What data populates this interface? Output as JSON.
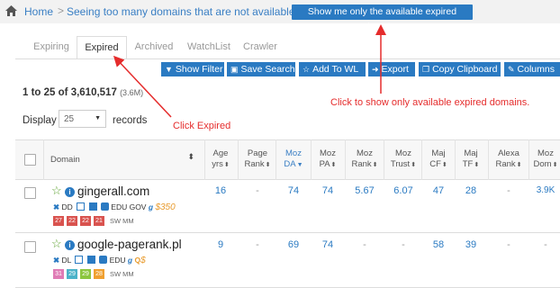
{
  "breadcrumb": {
    "home": "Home",
    "separator": ">",
    "text": "Seeing too many domains that are not available?"
  },
  "available_button": "Show me only the available expired domains",
  "tabs": [
    "Expiring",
    "Expired",
    "Archived",
    "WatchList",
    "Crawler"
  ],
  "active_tab": "Expired",
  "toolbar": {
    "show_filter": "Show Filter",
    "save_search": "Save Search",
    "add_to_wl": "Add To WL",
    "export": "Export",
    "copy_clipboard": "Copy Clipboard",
    "columns": "Columns"
  },
  "range": {
    "text": "1 to 25 of",
    "total": "3,610,517",
    "short": "(3.6M)"
  },
  "display": {
    "label": "Display",
    "value": "25",
    "suffix": "records"
  },
  "annotations": {
    "click_expired": "Click Expired",
    "click_available": "Click to show only available expired domains."
  },
  "columns": [
    {
      "key": "domain",
      "lines": [
        "Domain"
      ]
    },
    {
      "key": "age",
      "lines": [
        "Age",
        "yrs"
      ]
    },
    {
      "key": "page_rank",
      "lines": [
        "Page",
        "Rank"
      ]
    },
    {
      "key": "moz_da",
      "lines": [
        "Moz",
        "DA"
      ]
    },
    {
      "key": "moz_pa",
      "lines": [
        "Moz",
        "PA"
      ]
    },
    {
      "key": "moz_rank",
      "lines": [
        "Moz",
        "Rank"
      ]
    },
    {
      "key": "moz_trust",
      "lines": [
        "Moz",
        "Trust"
      ]
    },
    {
      "key": "maj_cf",
      "lines": [
        "Maj",
        "CF"
      ]
    },
    {
      "key": "maj_tf",
      "lines": [
        "Maj",
        "TF"
      ]
    },
    {
      "key": "alexa_rank",
      "lines": [
        "Alexa",
        "Rank"
      ]
    },
    {
      "key": "moz_dom",
      "lines": [
        "Moz",
        "Dom"
      ]
    }
  ],
  "rows": [
    {
      "domain": "gingerall.com",
      "sub": {
        "status": "DD",
        "edu": "EDU GOV",
        "price": "$350"
      },
      "badges": [
        {
          "text": "27",
          "color": "#d9534f"
        },
        {
          "text": "22",
          "color": "#d9534f"
        },
        {
          "text": "22",
          "color": "#d9534f"
        },
        {
          "text": "21",
          "color": "#d9534f"
        }
      ],
      "swmm": "SW MM",
      "values": {
        "age": "16",
        "page_rank": "-",
        "moz_da": "74",
        "moz_pa": "74",
        "moz_rank": "5.67",
        "moz_trust": "6.07",
        "maj_cf": "47",
        "maj_tf": "28",
        "alexa_rank": "-",
        "moz_dom": "3.9K"
      }
    },
    {
      "domain": "google-pagerank.pl",
      "sub": {
        "status": "DL",
        "edu": "EDU",
        "price": "$"
      },
      "badges": [
        {
          "text": "31",
          "color": "#e07bb5"
        },
        {
          "text": "29",
          "color": "#4bb3c9"
        },
        {
          "text": "29",
          "color": "#8cc63f"
        },
        {
          "text": "28",
          "color": "#f0a030"
        }
      ],
      "swmm": "SW MM",
      "values": {
        "age": "9",
        "page_rank": "-",
        "moz_da": "69",
        "moz_pa": "74",
        "moz_rank": "-",
        "moz_trust": "-",
        "maj_cf": "58",
        "maj_tf": "39",
        "alexa_rank": "-",
        "moz_dom": "-"
      }
    }
  ],
  "colors": {
    "accent": "#2a7ac2",
    "annotation": "#e52c2c",
    "star": "#5aa02c"
  }
}
